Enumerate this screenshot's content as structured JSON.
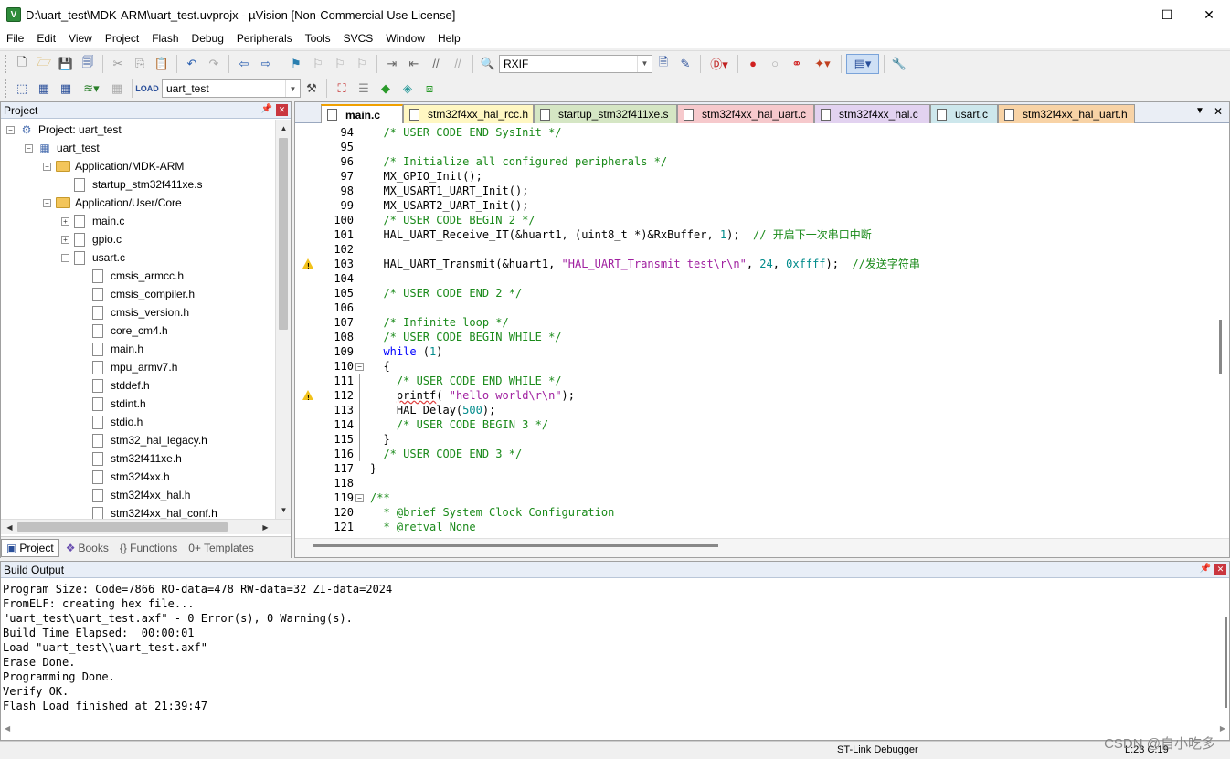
{
  "window": {
    "title": "D:\\uart_test\\MDK-ARM\\uart_test.uvprojx - µVision  [Non-Commercial Use License]",
    "app_icon": "V",
    "controls": [
      "–",
      "☐",
      "✕"
    ]
  },
  "menu": [
    "File",
    "Edit",
    "View",
    "Project",
    "Flash",
    "Debug",
    "Peripherals",
    "Tools",
    "SVCS",
    "Window",
    "Help"
  ],
  "toolbar": {
    "find_combo": "RXIF",
    "target_combo": "uart_test"
  },
  "project_panel": {
    "title": "Project",
    "tree": [
      {
        "label": "Project: uart_test",
        "level": 0,
        "exp": "−",
        "kind": "proj"
      },
      {
        "label": "uart_test",
        "level": 1,
        "exp": "−",
        "kind": "proj"
      },
      {
        "label": "Application/MDK-ARM",
        "level": 2,
        "exp": "−",
        "kind": "folder"
      },
      {
        "label": "startup_stm32f411xe.s",
        "level": 3,
        "exp": "",
        "kind": "file"
      },
      {
        "label": "Application/User/Core",
        "level": 2,
        "exp": "−",
        "kind": "folder"
      },
      {
        "label": "main.c",
        "level": 3,
        "exp": "+",
        "kind": "file"
      },
      {
        "label": "gpio.c",
        "level": 3,
        "exp": "+",
        "kind": "file"
      },
      {
        "label": "usart.c",
        "level": 3,
        "exp": "−",
        "kind": "file"
      },
      {
        "label": "cmsis_armcc.h",
        "level": 4,
        "exp": "",
        "kind": "file"
      },
      {
        "label": "cmsis_compiler.h",
        "level": 4,
        "exp": "",
        "kind": "file"
      },
      {
        "label": "cmsis_version.h",
        "level": 4,
        "exp": "",
        "kind": "file"
      },
      {
        "label": "core_cm4.h",
        "level": 4,
        "exp": "",
        "kind": "file"
      },
      {
        "label": "main.h",
        "level": 4,
        "exp": "",
        "kind": "file"
      },
      {
        "label": "mpu_armv7.h",
        "level": 4,
        "exp": "",
        "kind": "file"
      },
      {
        "label": "stddef.h",
        "level": 4,
        "exp": "",
        "kind": "file"
      },
      {
        "label": "stdint.h",
        "level": 4,
        "exp": "",
        "kind": "file"
      },
      {
        "label": "stdio.h",
        "level": 4,
        "exp": "",
        "kind": "file"
      },
      {
        "label": "stm32_hal_legacy.h",
        "level": 4,
        "exp": "",
        "kind": "file"
      },
      {
        "label": "stm32f411xe.h",
        "level": 4,
        "exp": "",
        "kind": "file"
      },
      {
        "label": "stm32f4xx.h",
        "level": 4,
        "exp": "",
        "kind": "file"
      },
      {
        "label": "stm32f4xx_hal.h",
        "level": 4,
        "exp": "",
        "kind": "file"
      },
      {
        "label": "stm32f4xx_hal_conf.h",
        "level": 4,
        "exp": "",
        "kind": "file"
      }
    ],
    "bottom_tabs": [
      "Project",
      "Books",
      "{} Functions",
      "0+ Templates"
    ]
  },
  "editor": {
    "tabs": [
      {
        "label": "main.c",
        "color": "#ffffff",
        "active": true
      },
      {
        "label": "stm32f4xx_hal_rcc.h",
        "color": "#fff7c2"
      },
      {
        "label": "startup_stm32f411xe.s",
        "color": "#d5e6c4"
      },
      {
        "label": "stm32f4xx_hal_uart.c",
        "color": "#f6c9cc"
      },
      {
        "label": "stm32f4xx_hal.c",
        "color": "#e2d2f0"
      },
      {
        "label": "usart.c",
        "color": "#cde7ec"
      },
      {
        "label": "stm32f4xx_hal_uart.h",
        "color": "#f8d3a6"
      }
    ],
    "lines": [
      {
        "n": "94",
        "mark": "",
        "segs": [
          {
            "t": "  ",
            "c": ""
          },
          {
            "t": "/* USER CODE END SysInit */",
            "c": "cm"
          }
        ]
      },
      {
        "n": "95",
        "mark": "",
        "segs": []
      },
      {
        "n": "96",
        "mark": "",
        "segs": [
          {
            "t": "  ",
            "c": ""
          },
          {
            "t": "/* Initialize all configured peripherals */",
            "c": "cm"
          }
        ]
      },
      {
        "n": "97",
        "mark": "",
        "segs": [
          {
            "t": "  MX_GPIO_Init();",
            "c": ""
          }
        ]
      },
      {
        "n": "98",
        "mark": "",
        "segs": [
          {
            "t": "  MX_USART1_UART_Init();",
            "c": ""
          }
        ]
      },
      {
        "n": "99",
        "mark": "",
        "segs": [
          {
            "t": "  MX_USART2_UART_Init();",
            "c": ""
          }
        ]
      },
      {
        "n": "100",
        "mark": "",
        "segs": [
          {
            "t": "  ",
            "c": ""
          },
          {
            "t": "/* USER CODE BEGIN 2 */",
            "c": "cm"
          }
        ]
      },
      {
        "n": "101",
        "mark": "",
        "segs": [
          {
            "t": "  HAL_UART_Receive_IT(&huart1, (uint8_t *)&RxBuffer, ",
            "c": ""
          },
          {
            "t": "1",
            "c": "num"
          },
          {
            "t": ");  ",
            "c": ""
          },
          {
            "t": "// 开启下一次串口中断",
            "c": "cm"
          }
        ]
      },
      {
        "n": "102",
        "mark": "",
        "segs": []
      },
      {
        "n": "103",
        "mark": "warn",
        "segs": [
          {
            "t": "  HAL_UART_Transmit(&huart1, ",
            "c": ""
          },
          {
            "t": "\"HAL_UART_Transmit test\\r\\n\"",
            "c": "str"
          },
          {
            "t": ", ",
            "c": ""
          },
          {
            "t": "24",
            "c": "num"
          },
          {
            "t": ", ",
            "c": ""
          },
          {
            "t": "0xffff",
            "c": "num"
          },
          {
            "t": ");  ",
            "c": ""
          },
          {
            "t": "//发送字符串",
            "c": "cm"
          }
        ]
      },
      {
        "n": "104",
        "mark": "",
        "segs": []
      },
      {
        "n": "105",
        "mark": "",
        "segs": [
          {
            "t": "  ",
            "c": ""
          },
          {
            "t": "/* USER CODE END 2 */",
            "c": "cm"
          }
        ]
      },
      {
        "n": "106",
        "mark": "",
        "segs": []
      },
      {
        "n": "107",
        "mark": "",
        "segs": [
          {
            "t": "  ",
            "c": ""
          },
          {
            "t": "/* Infinite loop */",
            "c": "cm"
          }
        ]
      },
      {
        "n": "108",
        "mark": "",
        "segs": [
          {
            "t": "  ",
            "c": ""
          },
          {
            "t": "/* USER CODE BEGIN WHILE */",
            "c": "cm"
          }
        ]
      },
      {
        "n": "109",
        "mark": "",
        "segs": [
          {
            "t": "  ",
            "c": ""
          },
          {
            "t": "while",
            "c": "kw"
          },
          {
            "t": " (",
            "c": ""
          },
          {
            "t": "1",
            "c": "num"
          },
          {
            "t": ")",
            "c": ""
          }
        ]
      },
      {
        "n": "110",
        "mark": "fold",
        "segs": [
          {
            "t": "  {",
            "c": ""
          }
        ]
      },
      {
        "n": "111",
        "mark": "",
        "segs": [
          {
            "t": "    ",
            "c": ""
          },
          {
            "t": "/* USER CODE END WHILE */",
            "c": "cm"
          }
        ]
      },
      {
        "n": "112",
        "mark": "warn",
        "segs": [
          {
            "t": "    ",
            "c": ""
          },
          {
            "t": "printf",
            "c": "sq"
          },
          {
            "t": "( ",
            "c": ""
          },
          {
            "t": "\"hello world\\r\\n\"",
            "c": "str"
          },
          {
            "t": ");",
            "c": ""
          }
        ]
      },
      {
        "n": "113",
        "mark": "",
        "segs": [
          {
            "t": "    HAL_Delay(",
            "c": ""
          },
          {
            "t": "500",
            "c": "num"
          },
          {
            "t": ");",
            "c": ""
          }
        ]
      },
      {
        "n": "114",
        "mark": "",
        "segs": [
          {
            "t": "    ",
            "c": ""
          },
          {
            "t": "/* USER CODE BEGIN 3 */",
            "c": "cm"
          }
        ]
      },
      {
        "n": "115",
        "mark": "",
        "segs": [
          {
            "t": "  }",
            "c": ""
          }
        ]
      },
      {
        "n": "116",
        "mark": "",
        "segs": [
          {
            "t": "  ",
            "c": ""
          },
          {
            "t": "/* USER CODE END 3 */",
            "c": "cm"
          }
        ]
      },
      {
        "n": "117",
        "mark": "",
        "segs": [
          {
            "t": "}",
            "c": ""
          }
        ]
      },
      {
        "n": "118",
        "mark": "",
        "segs": []
      },
      {
        "n": "119",
        "mark": "fold",
        "segs": [
          {
            "t": "/**",
            "c": "cm"
          }
        ]
      },
      {
        "n": "120",
        "mark": "",
        "segs": [
          {
            "t": "  ",
            "c": ""
          },
          {
            "t": "* @brief System Clock Configuration",
            "c": "cm"
          }
        ]
      },
      {
        "n": "121",
        "mark": "",
        "segs": [
          {
            "t": "  ",
            "c": ""
          },
          {
            "t": "* @retval None",
            "c": "cm"
          }
        ]
      }
    ]
  },
  "build_output": {
    "title": "Build Output",
    "lines": [
      "Program Size: Code=7866 RO-data=478 RW-data=32 ZI-data=2024",
      "FromELF: creating hex file...",
      "\"uart_test\\uart_test.axf\" - 0 Error(s), 0 Warning(s).",
      "Build Time Elapsed:  00:00:01",
      "Load \"uart_test\\\\uart_test.axf\"",
      "Erase Done.",
      "Programming Done.",
      "Verify OK.",
      "Flash Load finished at 21:39:47"
    ]
  },
  "status": {
    "debugger": "ST-Link Debugger",
    "position": "L:23 C:19"
  },
  "watermark": "CSDN @自小吃多"
}
